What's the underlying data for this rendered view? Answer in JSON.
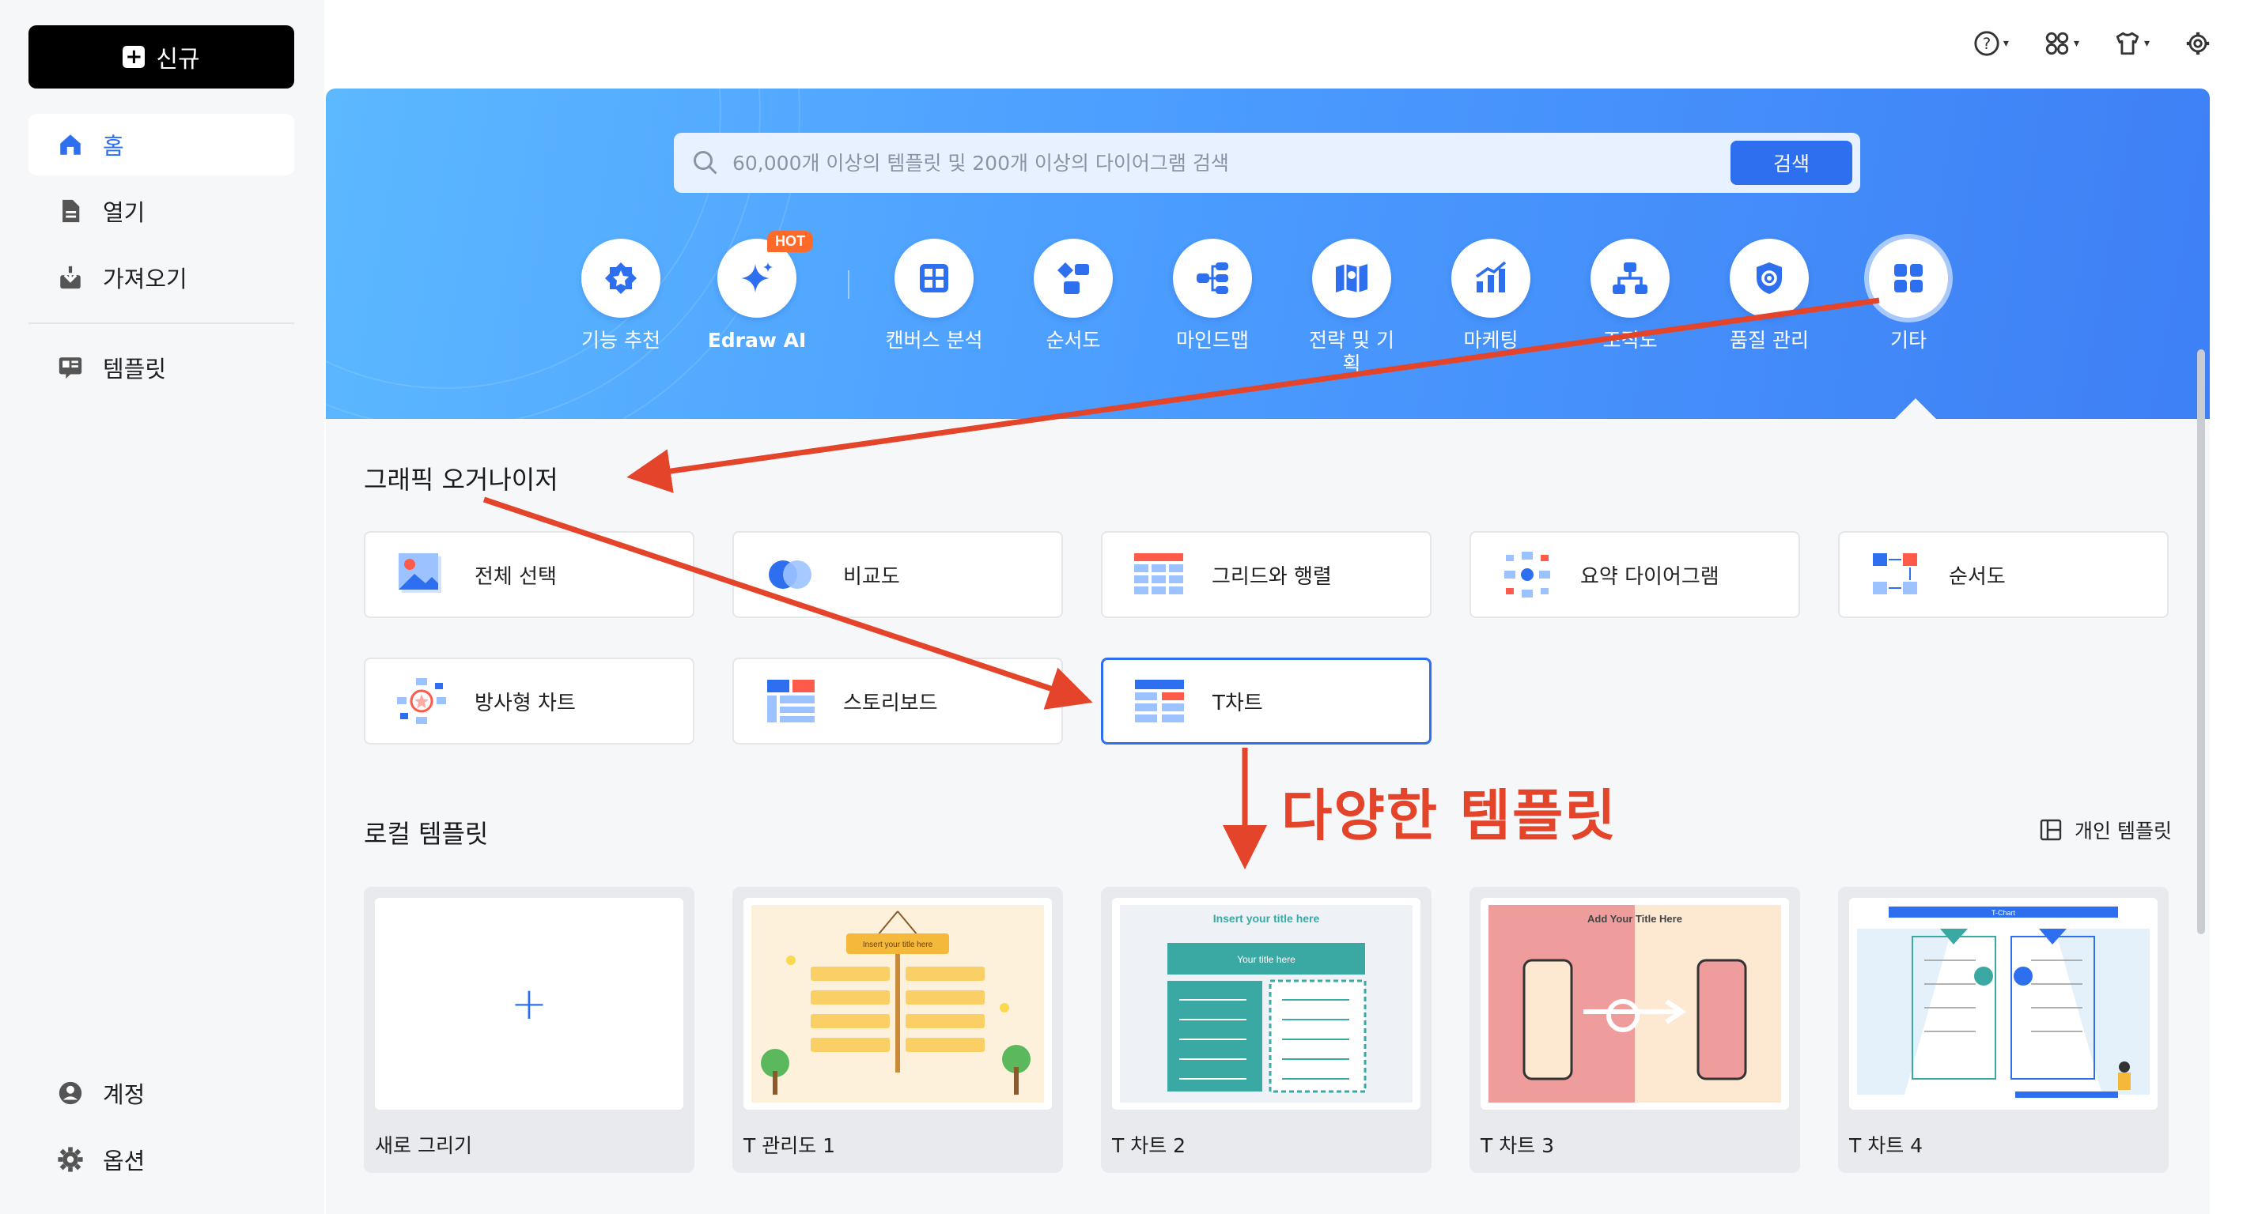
{
  "sidebar": {
    "new_button": "신규",
    "items": [
      {
        "label": "홈",
        "icon": "home-icon"
      },
      {
        "label": "열기",
        "icon": "file-icon"
      },
      {
        "label": "가져오기",
        "icon": "import-icon"
      },
      {
        "label": "템플릿",
        "icon": "template-icon"
      }
    ],
    "bottom_items": [
      {
        "label": "계정",
        "icon": "user-icon"
      },
      {
        "label": "옵션",
        "icon": "gear-icon"
      }
    ]
  },
  "search": {
    "placeholder": "60,000개 이상의 템플릿 및 200개 이상의 다이어그램 검색",
    "button": "검색"
  },
  "categories": [
    {
      "label": "기능 추천",
      "icon": "star-badge-icon"
    },
    {
      "label": "Edraw AI",
      "icon": "sparkle-icon",
      "badge": "HOT"
    },
    {
      "label": "캔버스 분석",
      "icon": "grid-icon"
    },
    {
      "label": "순서도",
      "icon": "flowchart-icon"
    },
    {
      "label": "마인드맵",
      "icon": "mindmap-icon"
    },
    {
      "label": "전략 및 기",
      "label2": "획",
      "icon": "map-icon"
    },
    {
      "label": "마케팅",
      "icon": "bar-chart-icon"
    },
    {
      "label": "조직도",
      "icon": "org-chart-icon"
    },
    {
      "label": "품질 관리",
      "icon": "shield-icon"
    },
    {
      "label": "기타",
      "icon": "apps-icon"
    }
  ],
  "graphic_organizer": {
    "title": "그래픽 오거나이저",
    "cards": [
      {
        "label": "전체 선택",
        "icon": "image-icon"
      },
      {
        "label": "비교도",
        "icon": "venn-icon"
      },
      {
        "label": "그리드와 행렬",
        "icon": "grid-table-icon"
      },
      {
        "label": "요약 다이어그램",
        "icon": "summary-icon"
      },
      {
        "label": "순서도",
        "icon": "flow-icon"
      },
      {
        "label": "방사형 차트",
        "icon": "radial-icon"
      },
      {
        "label": "스토리보드",
        "icon": "storyboard-icon"
      },
      {
        "label": "T차트",
        "icon": "t-chart-icon"
      }
    ]
  },
  "local_templates": {
    "title": "로컬 템플릿",
    "personal_button": "개인 템플릿",
    "items": [
      {
        "name": "새로 그리기"
      },
      {
        "name": "T 관리도 1",
        "thumb_title": "Insert your title here"
      },
      {
        "name": "T 차트 2",
        "thumb_title": "Insert your title here",
        "thumb_sub": "Your title here"
      },
      {
        "name": "T 차트 3",
        "thumb_title": "Add Your Title Here"
      },
      {
        "name": "T 차트 4",
        "thumb_title": "T-Chart"
      }
    ]
  },
  "annotation": {
    "text": "다양한 템플릿"
  },
  "colors": {
    "accent": "#2e6ff0",
    "banner_start": "#5cb8ff",
    "banner_end": "#3e7ff5",
    "annotation": "#e4442a"
  }
}
